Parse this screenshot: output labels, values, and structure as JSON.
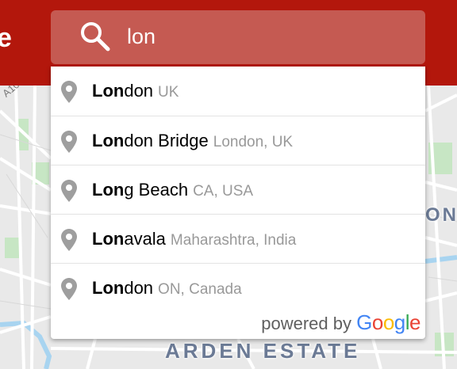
{
  "header": {
    "brand_letter": "e"
  },
  "search": {
    "value": "lon",
    "icon": "search-icon"
  },
  "suggestions": [
    {
      "match": "Lon",
      "rest": "don",
      "secondary": "UK"
    },
    {
      "match": "Lon",
      "rest": "don Bridge",
      "secondary": "London, UK"
    },
    {
      "match": "Lon",
      "rest": "g Beach",
      "secondary": "CA, USA"
    },
    {
      "match": "Lon",
      "rest": "avala",
      "secondary": "Maharashtra, India"
    },
    {
      "match": "Lon",
      "rest": "don",
      "secondary": "ON, Canada"
    }
  ],
  "powered_by": {
    "prefix": "powered by",
    "google": [
      "G",
      "o",
      "o",
      "g",
      "l",
      "e"
    ]
  },
  "map": {
    "label_estate": "ARDEN ESTATE",
    "label_right": "ON",
    "label_road": "A10"
  },
  "colors": {
    "header": "#b3170c",
    "search_box": "#c55a52",
    "pin": "#9e9e9e",
    "google_blue": "#4285f4",
    "google_red": "#ea4335",
    "google_yellow": "#fbbc05",
    "google_green": "#34a853"
  }
}
